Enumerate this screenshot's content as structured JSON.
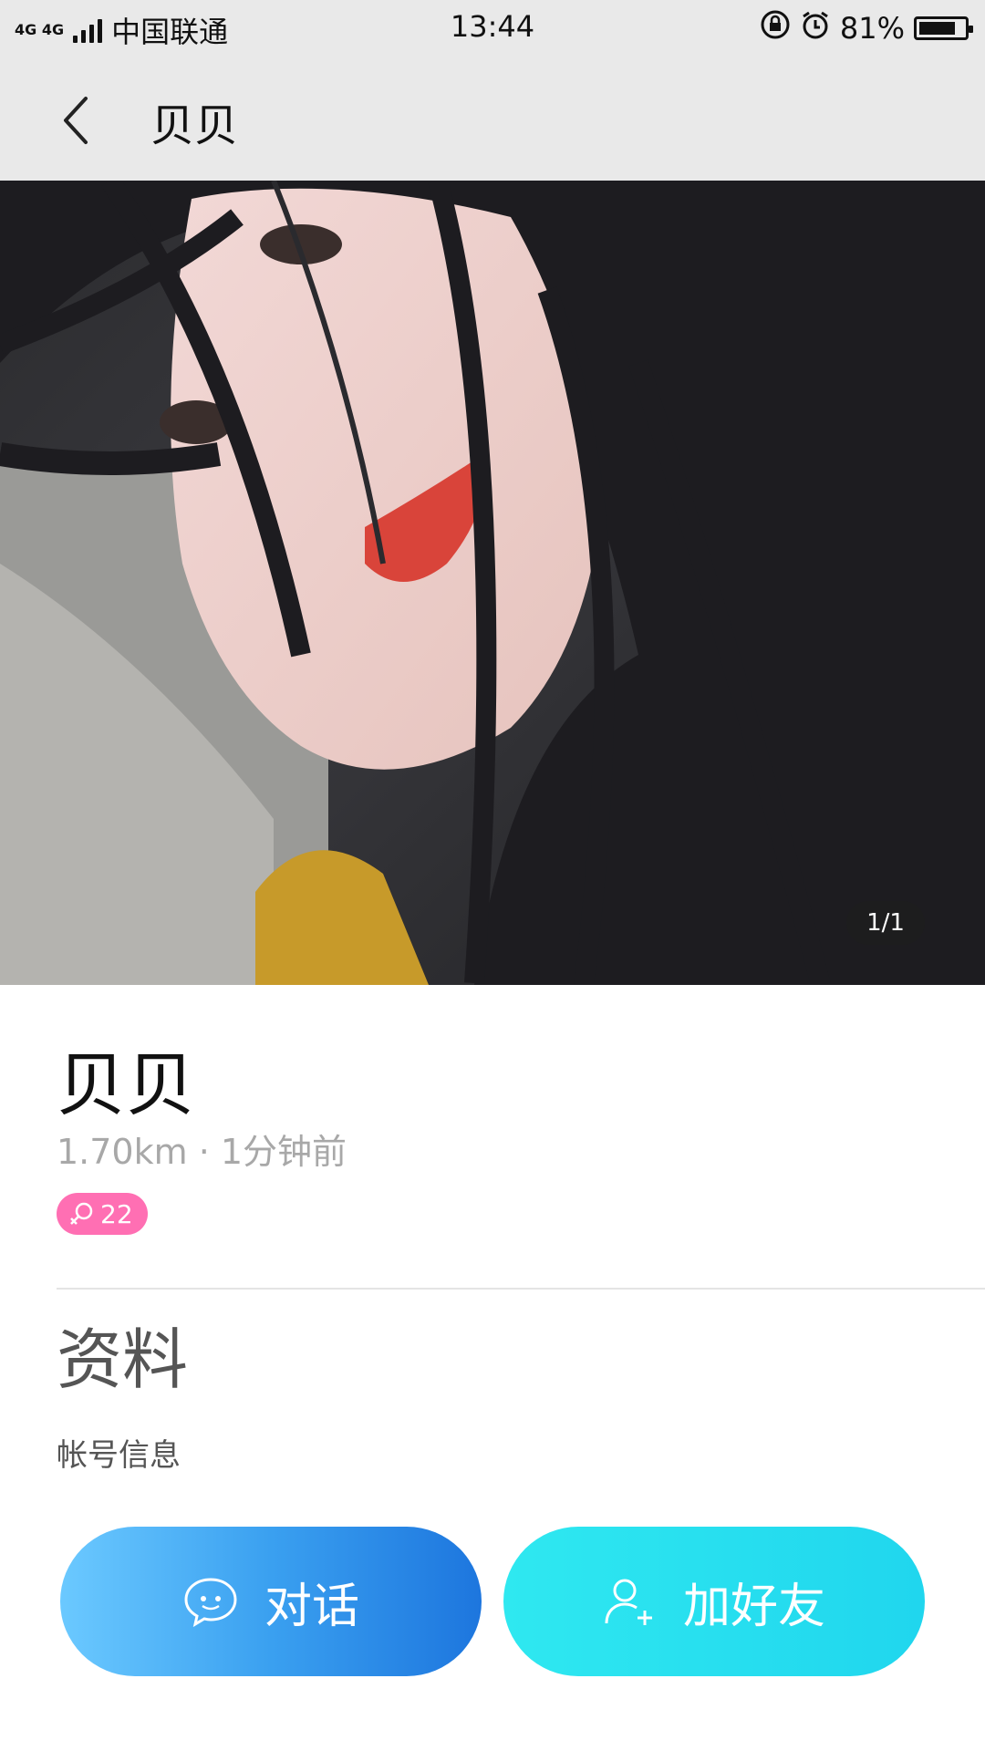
{
  "status_bar": {
    "network": "4G 4G",
    "carrier": "中国联通",
    "time": "13:44",
    "battery_percent": "81%",
    "battery_level": 0.81,
    "icons": [
      "signal-icon",
      "rotation-lock-icon",
      "alarm-icon",
      "battery-icon"
    ]
  },
  "nav": {
    "back_icon": "chevron-left-icon",
    "title": "贝贝"
  },
  "photo": {
    "counter": "1/1"
  },
  "profile": {
    "name": "贝贝",
    "meta": "1.70km · 1分钟前",
    "badge": {
      "icon": "female-icon",
      "age": "22",
      "color": "#ff6fb3"
    }
  },
  "section": {
    "title": "资料",
    "item": "帐号信息"
  },
  "actions": {
    "chat_label": "对话",
    "chat_icon": "chat-bubble-icon",
    "add_friend_label": "加好友",
    "add_friend_icon": "add-user-icon"
  }
}
